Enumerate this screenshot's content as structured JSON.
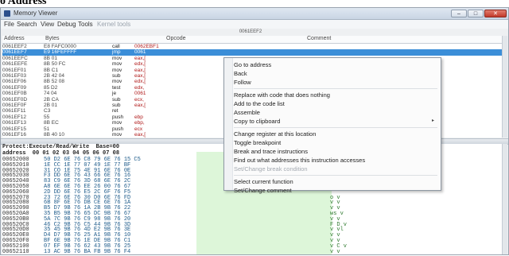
{
  "page_header": "o Address",
  "window": {
    "title": "Memory Viewer",
    "minimize": "–",
    "maximize": "□",
    "close": "✕"
  },
  "menu": [
    "File",
    "Search",
    "View",
    "Debug",
    "Tools",
    "Kernel tools"
  ],
  "disassembler": {
    "current_address": "0061EEF2",
    "headers": {
      "address": "Address",
      "bytes": "Bytes",
      "opcode": "Opcode",
      "comment": "Comment"
    },
    "rows": [
      {
        "address": "0061EEF2",
        "bytes": "E8 FAFC0000",
        "opcode": "call",
        "args": "0062EBF1",
        "selected": false
      },
      {
        "address": "0061EEF7",
        "bytes": "E9 16FEFFFF",
        "opcode": "jmp",
        "args": "0061",
        "selected": true
      },
      {
        "address": "0061EEFC",
        "bytes": "8B 01",
        "opcode": "mov",
        "args": "eax,[",
        "selected": false
      },
      {
        "address": "0061EEFE",
        "bytes": "8B 50 FC",
        "opcode": "mov",
        "args": "edx,[",
        "selected": false
      },
      {
        "address": "0061EF01",
        "bytes": "8B C1",
        "opcode": "mov",
        "args": "eax,[",
        "selected": false
      },
      {
        "address": "0061EF03",
        "bytes": "2B 42 04",
        "opcode": "sub",
        "args": "eax,[",
        "selected": false
      },
      {
        "address": "0061EF06",
        "bytes": "8B 52 08",
        "opcode": "mov",
        "args": "edx,[",
        "selected": false
      },
      {
        "address": "0061EF09",
        "bytes": "85 D2",
        "opcode": "test",
        "args": "edx,",
        "selected": false
      },
      {
        "address": "0061EF0B",
        "bytes": "74 04",
        "opcode": "je",
        "args": "0061",
        "selected": false
      },
      {
        "address": "0061EF0D",
        "bytes": "2B CA",
        "opcode": "sub",
        "args": "ecx,",
        "selected": false
      },
      {
        "address": "0061EF0F",
        "bytes": "2B 01",
        "opcode": "sub",
        "args": "eax,[",
        "selected": false
      },
      {
        "address": "0061EF11",
        "bytes": "C3",
        "opcode": "ret",
        "args": "",
        "selected": false
      },
      {
        "address": "0061EF12",
        "bytes": "55",
        "opcode": "push",
        "args": "ebp",
        "selected": false
      },
      {
        "address": "0061EF13",
        "bytes": "8B EC",
        "opcode": "mov",
        "args": "ebp,",
        "selected": false
      },
      {
        "address": "0061EF15",
        "bytes": "51",
        "opcode": "push",
        "args": "ecx",
        "selected": false
      },
      {
        "address": "0061EF16",
        "bytes": "8B 40 10",
        "opcode": "mov",
        "args": "eax,[",
        "selected": false
      }
    ]
  },
  "hex_view": {
    "protect_line": "Protect:Execute/Read/Write  Base=00",
    "header_line": "address  00 01 02 03 04 05 06 07 08",
    "rows": [
      {
        "address": "00652000",
        "bytes": "50 D2 6E 76 C8 79 6E 76 15 C5",
        "ascii": ""
      },
      {
        "address": "00652010",
        "bytes": "1E CC 1E 77 07 49 1E 77 BF",
        "ascii": ""
      },
      {
        "address": "00652020",
        "bytes": "31 CO 1E 75 4E 91 6E 76 0E",
        "ascii": ""
      },
      {
        "address": "00652030",
        "bytes": "F3 DD 6E 76 43 66 6E 76 16",
        "ascii": ""
      },
      {
        "address": "00652040",
        "bytes": "83 C9 6E 76 3D 68 6E 76 2C",
        "ascii": ""
      },
      {
        "address": "00652050",
        "bytes": "A8 6E 6E 76 EE 26 00 76 67",
        "ascii": ""
      },
      {
        "address": "00652060",
        "bytes": "2D DD 6E 76 E5 2C 6F 76 F5",
        "ascii": ""
      },
      {
        "address": "00652070",
        "bytes": "23 72 6E 76 30 D0 6E 76 FD",
        "ascii": "o v"
      },
      {
        "address": "00652080",
        "bytes": "6B 8F 6E 76 DB CE 6E 76 1A",
        "ascii": "v v"
      },
      {
        "address": "00652090",
        "bytes": "B5 D7 9B 76 1A 2B 9B 76 22",
        "ascii": "v v"
      },
      {
        "address": "006520A0",
        "bytes": "35 B5 9B 76 65 DC 9B 76 67",
        "ascii": "ws v"
      },
      {
        "address": "006520B0",
        "bytes": "5A 7C 9B 76 C9 98 9B 76 20",
        "ascii": "v v"
      },
      {
        "address": "006520C0",
        "bytes": "46 C2 9B 76 C5 44 9B 76 3D",
        "ascii": "F D v"
      },
      {
        "address": "006520D0",
        "bytes": "35 45 9B 76 4D E2 9B 76 3E",
        "ascii": "v vl"
      },
      {
        "address": "006520E0",
        "bytes": "D4 D7 9B 76 25 A1 9B 76 10",
        "ascii": "v v"
      },
      {
        "address": "006520F0",
        "bytes": "BF 6E 9B 76 1E DE 9B 76 C1",
        "ascii": "v v"
      },
      {
        "address": "00652100",
        "bytes": "07 EF 9B 76 62 43 9B 76 25",
        "ascii": "v C v"
      },
      {
        "address": "00652110",
        "bytes": "13 AC 9B 76 BA FB 9B 76 F4",
        "ascii": "v v"
      }
    ]
  },
  "context_menu": {
    "items": [
      {
        "label": "Go to address",
        "disabled": false,
        "submenu": false
      },
      {
        "label": "Back",
        "disabled": false,
        "submenu": false
      },
      {
        "label": "Follow",
        "disabled": false,
        "submenu": false
      },
      {
        "sep": true
      },
      {
        "label": "Replace with code that does nothing",
        "disabled": false,
        "submenu": false
      },
      {
        "label": "Add to the code list",
        "disabled": false,
        "submenu": false
      },
      {
        "label": "Assemble",
        "disabled": false,
        "submenu": false
      },
      {
        "label": "Copy to clipboard",
        "disabled": false,
        "submenu": true
      },
      {
        "sep": true
      },
      {
        "label": "Change register at this location",
        "disabled": false,
        "submenu": false
      },
      {
        "label": "Toggle breakpoint",
        "disabled": false,
        "submenu": false
      },
      {
        "label": "Break and trace instructions",
        "disabled": false,
        "submenu": false
      },
      {
        "label": "Find out what addresses this instruction accesses",
        "disabled": false,
        "submenu": false
      },
      {
        "label": "Set/Change break condition",
        "disabled": true,
        "submenu": false
      },
      {
        "sep": true
      },
      {
        "label": "Select current function",
        "disabled": false,
        "submenu": false
      },
      {
        "label": "Set/Change comment",
        "disabled": false,
        "submenu": false
      }
    ],
    "submenu_arrow": "▸"
  },
  "colors": {
    "selection": "#3b8ed8",
    "opcode_arg": "#b01a1a",
    "hex_bytes": "#1c5a8a",
    "hex_ascii": "#2f7a2f"
  }
}
